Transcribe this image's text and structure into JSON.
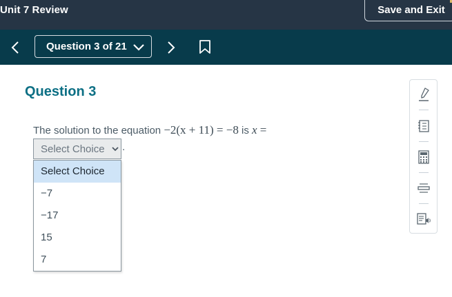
{
  "header": {
    "title": "Unit 7 Review",
    "save_label": "Save and Exit"
  },
  "nav": {
    "question_selector": "Question 3 of 21",
    "prev_icon": "chevron-left-icon",
    "next_icon": "chevron-right-icon",
    "bookmark_icon": "bookmark-icon"
  },
  "question": {
    "heading": "Question 3",
    "prompt_text": "The solution to the equation",
    "equation": "−2(x + 11) = −8",
    "is_text": "is",
    "answer_var": "x",
    "equals": "=",
    "period": "."
  },
  "answer_select": {
    "current_value": "Select Choice",
    "options": [
      "Select Choice",
      "−7",
      "−17",
      "15",
      "7"
    ]
  },
  "tools": [
    {
      "name": "highlighter-icon"
    },
    {
      "name": "notepad-icon"
    },
    {
      "name": "calculator-icon"
    },
    {
      "name": "line-reader-icon"
    },
    {
      "name": "text-to-speech-icon"
    }
  ],
  "colors": {
    "topbar": "#263545",
    "navbar": "#083b4b",
    "heading": "#0c6f84",
    "selected_option": "#cfe4f7"
  }
}
